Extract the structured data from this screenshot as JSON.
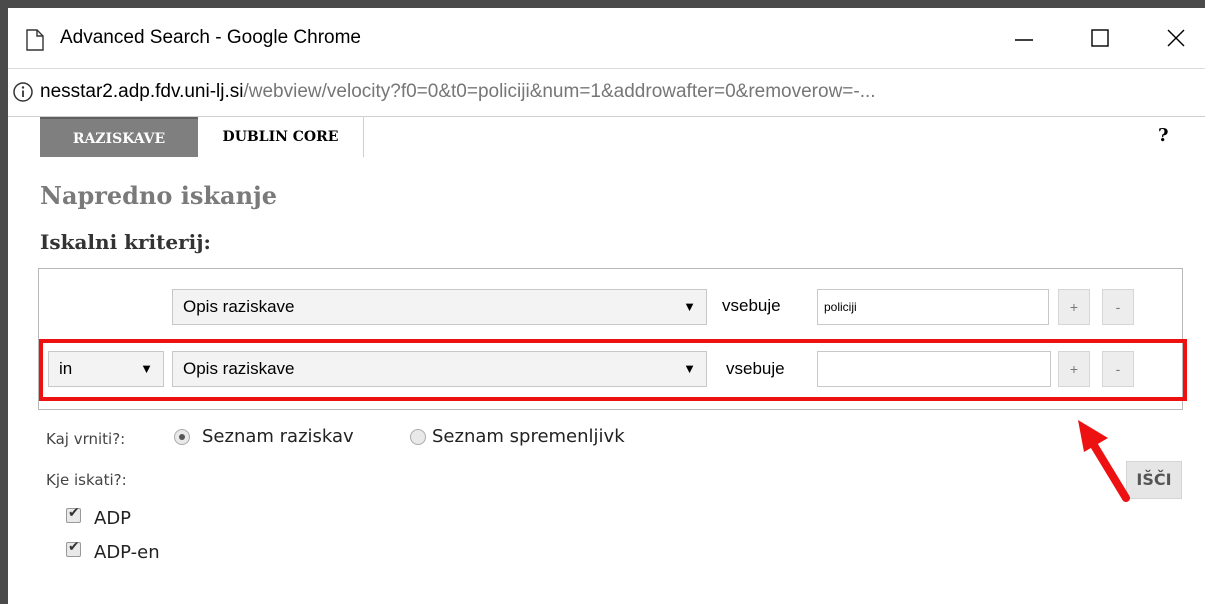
{
  "window": {
    "title": "Advanced Search - Google Chrome",
    "url_host": "nesstar2.adp.fdv.uni-lj.si",
    "url_path": "/webview/velocity?f0=0&t0=policiji&num=1&addrowafter=0&removerow=-..."
  },
  "tabs": [
    {
      "label": "RAZISKAVE",
      "active": true
    },
    {
      "label": "DUBLIN CORE",
      "active": false
    }
  ],
  "help_label": "?",
  "heading": "Napredno iskanje",
  "criteria_heading": "Iskalni kriterij:",
  "rows": [
    {
      "field": "Opis raziskave",
      "operator": "vsebuje",
      "value": "policiji",
      "plus": "+",
      "minus": "-"
    },
    {
      "connector": "in",
      "field": "Opis raziskave",
      "operator": "vsebuje",
      "value": "",
      "plus": "+",
      "minus": "-"
    }
  ],
  "return_label": "Kaj vrniti?:",
  "return_options": [
    {
      "label": "Seznam raziskav",
      "selected": true
    },
    {
      "label": "Seznam spremenljivk",
      "selected": false
    }
  ],
  "where_label": "Kje iskati?:",
  "sources": [
    {
      "label": "ADP",
      "checked": true
    },
    {
      "label": "ADP-en",
      "checked": true
    }
  ],
  "search_button": "IŠČI",
  "icons": {
    "page": "page-icon",
    "minimize": "minimize-icon",
    "maximize": "maximize-icon",
    "close": "close-icon",
    "info": "info-icon",
    "dropdown": "chevron-down-icon",
    "annotation": "arrow-icon"
  },
  "colors": {
    "highlight": "#ee1111",
    "active_tab": "#7f7f7f"
  }
}
